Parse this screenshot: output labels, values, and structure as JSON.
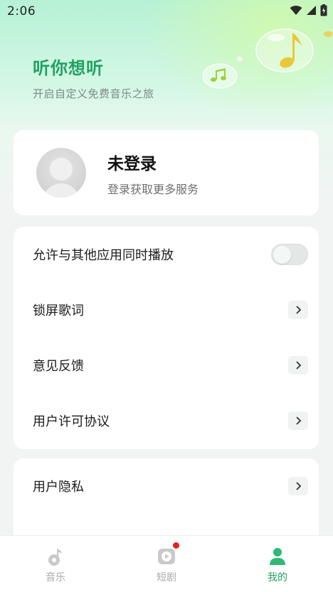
{
  "status_bar": {
    "time": "2:06",
    "icons": [
      "wifi-icon",
      "cellular-signal-icon",
      "battery-icon"
    ]
  },
  "hero": {
    "title": "听你想听",
    "subtitle": "开启自定义免费音乐之旅"
  },
  "profile": {
    "name": "未登录",
    "description": "登录获取更多服务"
  },
  "settings": {
    "items": [
      {
        "label": "允许与其他应用同时播放",
        "control": "toggle",
        "enabled": false
      },
      {
        "label": "锁屏歌词",
        "control": "chevron"
      },
      {
        "label": "意见反馈",
        "control": "chevron"
      },
      {
        "label": "用户许可协议",
        "control": "chevron"
      }
    ]
  },
  "settings2": {
    "items": [
      {
        "label": "用户隐私",
        "control": "chevron"
      }
    ]
  },
  "bottom_nav": {
    "items": [
      {
        "label": "音乐",
        "icon": "music-note-icon",
        "active": false
      },
      {
        "label": "短剧",
        "icon": "play-video-icon",
        "active": false,
        "badge": true
      },
      {
        "label": "我的",
        "icon": "person-icon",
        "active": true
      }
    ]
  },
  "colors": {
    "accent": "#22a162",
    "badge": "#e8201c",
    "background": "#f2f3f3"
  }
}
